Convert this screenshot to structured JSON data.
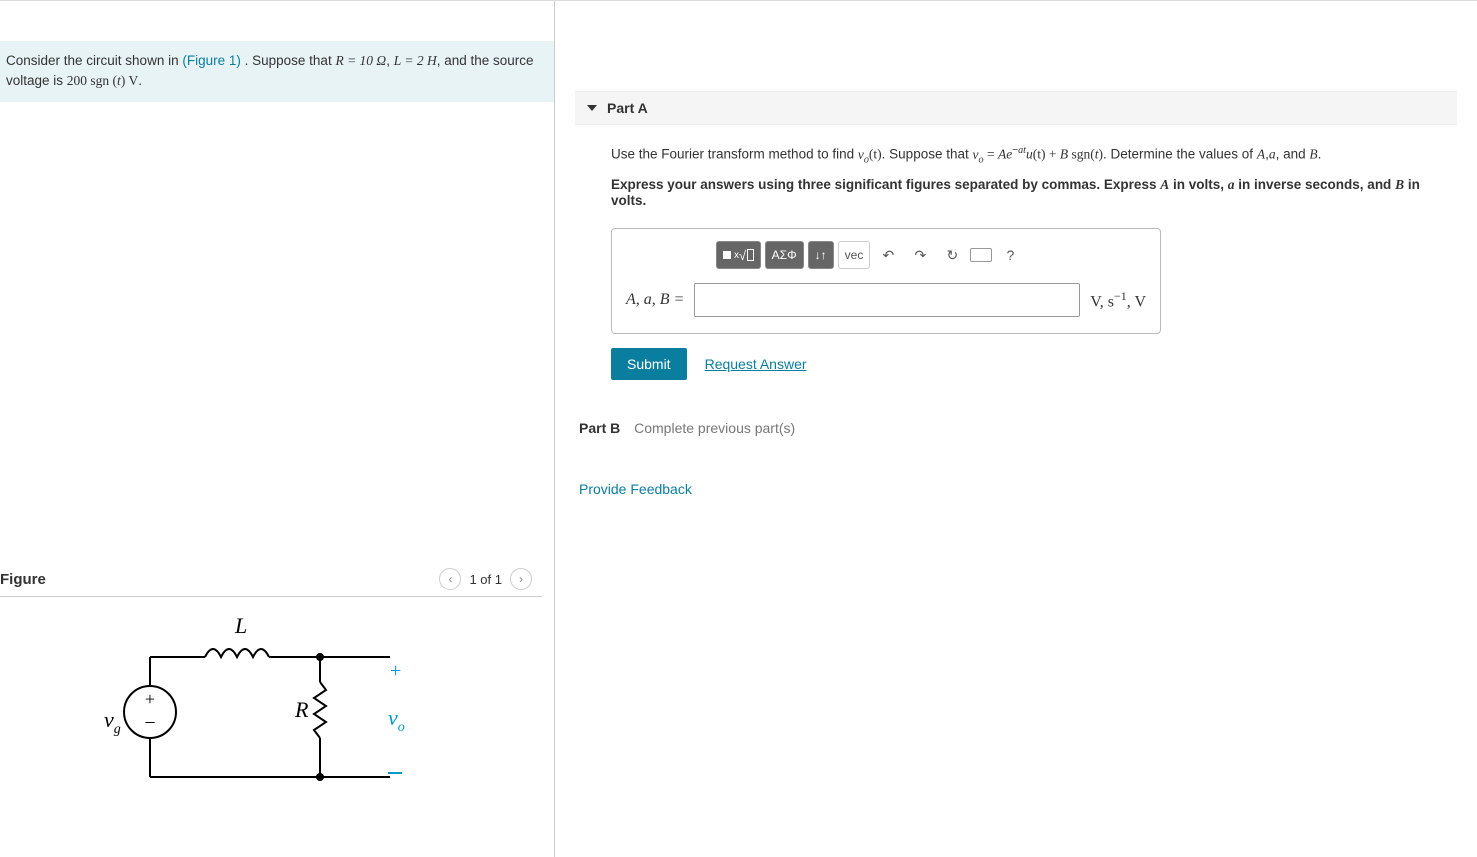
{
  "problem": {
    "prefix": "Consider the circuit shown in ",
    "figure_link": "(Figure 1)",
    "mid1": ". Suppose that ",
    "R_eq": "R = 10 Ω",
    "comma": ", ",
    "L_eq": "L = 2 H",
    "mid2": ", and the source voltage is ",
    "vsrc1": "200 sgn (",
    "vsrc_t": "t",
    "vsrc2": ")  V",
    "period": "."
  },
  "figure": {
    "title": "Figure",
    "counter": "1 of 1",
    "labels": {
      "L": "L",
      "R": "R",
      "vg": "v",
      "vg_sub": "g",
      "vo": "v",
      "vo_sub": "o",
      "plus": "+",
      "minus": "−"
    }
  },
  "partA": {
    "header": "Part A",
    "instr_prefix": "Use the Fourier transform method to find ",
    "vo": "v",
    "vo_sub": "o",
    "vo_arg": "(t)",
    "instr_mid": ". Suppose that ",
    "eq_lhs_v": "v",
    "eq_lhs_sub": "o",
    "eq_eq": " = ",
    "eq_A": "A",
    "eq_e": "e",
    "eq_exp_neg": "−",
    "eq_exp_a": "a",
    "eq_exp_t": "t",
    "eq_u": "u",
    "eq_u_arg": "(t)",
    "eq_plus": " + ",
    "eq_B": "B",
    "eq_sgn": " sgn(",
    "eq_sgn_t": "t",
    "eq_sgn_close": ")",
    "instr_suffix1": ". Determine the values of ",
    "A": "A",
    "sep1": ",",
    "a": "a",
    "sep2": ", and ",
    "B": "B",
    "instr_suffix2": ".",
    "bold_prefix": "Express your answers using three significant figures separated by commas. Express ",
    "bold_A": "A",
    "bold_mid1": " in volts, ",
    "bold_a": "a",
    "bold_mid2": " in inverse seconds, and ",
    "bold_B": "B",
    "bold_suffix": " in volts.",
    "toolbar": {
      "templates": "x√",
      "greek": "ΑΣΦ",
      "subscript": "↓↑",
      "vec": "vec",
      "undo": "↶",
      "redo": "↷",
      "reset": "↻",
      "keyboard": "⌨",
      "help": "?"
    },
    "answer_label": "A, a, B = ",
    "answer_units": "V, s⁻¹, V",
    "submit": "Submit",
    "request": "Request Answer"
  },
  "partB": {
    "title": "Part B",
    "msg": "Complete previous part(s)"
  },
  "feedback": "Provide Feedback"
}
